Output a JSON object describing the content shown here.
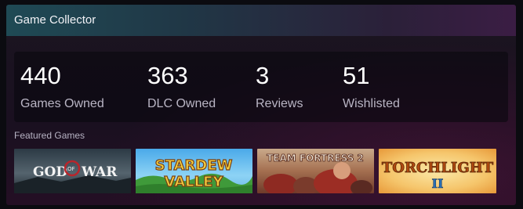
{
  "widget": {
    "title": "Game Collector"
  },
  "stats": [
    {
      "value": "440",
      "label": "Games Owned"
    },
    {
      "value": "363",
      "label": "DLC Owned"
    },
    {
      "value": "3",
      "label": "Reviews"
    },
    {
      "value": "51",
      "label": "Wishlisted"
    }
  ],
  "featured": {
    "label": "Featured Games",
    "games": [
      {
        "logo_text_1": "GOD",
        "logo_text_2": "OF",
        "logo_text_3": "WAR"
      },
      {
        "logo_text_1": "STARDEW",
        "logo_text_2": "VALLEY"
      },
      {
        "logo_text_1": "TEAM FORTRESS 2"
      },
      {
        "logo_text_1": "TORCHLIGHT",
        "logo_text_2": "II"
      }
    ]
  },
  "colors": {
    "header_start": "#1f4a55",
    "header_end": "#3b1d44",
    "text_primary": "#ffffff",
    "text_secondary": "#b9b5c4"
  }
}
